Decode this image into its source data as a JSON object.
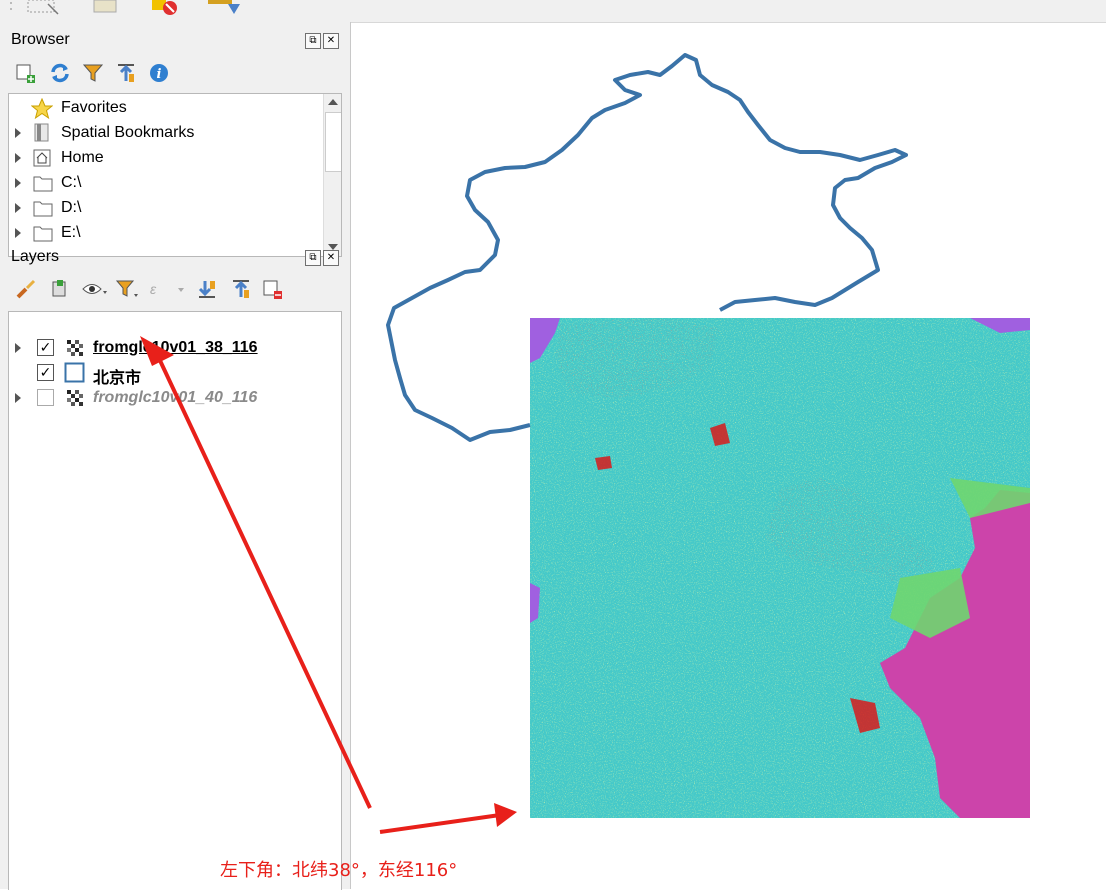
{
  "colors": {
    "panel_bg": "#f0f0f0",
    "boundary_line": "#3a73a8",
    "raster_water": "#45c9c9",
    "raster_grass": "#6fd66f",
    "raster_built": "#d81a1a",
    "raster_bare": "#cc44aa",
    "raster_purple": "#a060e0",
    "annotation_red": "#e8201a"
  },
  "browser_panel": {
    "title": "Browser",
    "toolbar_icons": [
      "add-layer-icon",
      "refresh-icon",
      "filter-icon",
      "collapse-all-icon",
      "info-icon"
    ],
    "items": [
      {
        "label": "Favorites",
        "icon": "star-icon",
        "expandable": false
      },
      {
        "label": "Spatial Bookmarks",
        "icon": "bookmark-icon",
        "expandable": true
      },
      {
        "label": "Home",
        "icon": "home-icon",
        "expandable": true
      },
      {
        "label": "C:\\",
        "icon": "folder-icon",
        "expandable": true
      },
      {
        "label": "D:\\",
        "icon": "folder-icon",
        "expandable": true
      },
      {
        "label": "E:\\",
        "icon": "folder-icon",
        "expandable": true
      }
    ]
  },
  "layers_panel": {
    "title": "Layers",
    "toolbar_icons": [
      "style-brush-icon",
      "add-group-icon",
      "visibility-eye-icon",
      "filter-legend-icon",
      "expression-filter-icon",
      "expand-all-icon",
      "collapse-all-icon",
      "remove-layer-icon"
    ],
    "layers": [
      {
        "label": "fromglc10v01_38_116",
        "checked": true,
        "style": "bold-underline",
        "icon": "raster-icon",
        "expandable": true
      },
      {
        "label": "北京市",
        "checked": true,
        "style": "bold",
        "icon": "polygon-icon",
        "expandable": false
      },
      {
        "label": "fromglc10v01_40_116",
        "checked": false,
        "style": "italic-gray",
        "icon": "raster-icon",
        "expandable": true
      }
    ]
  },
  "annotation": {
    "caption": "左下角：北纬38°，东经116°"
  }
}
